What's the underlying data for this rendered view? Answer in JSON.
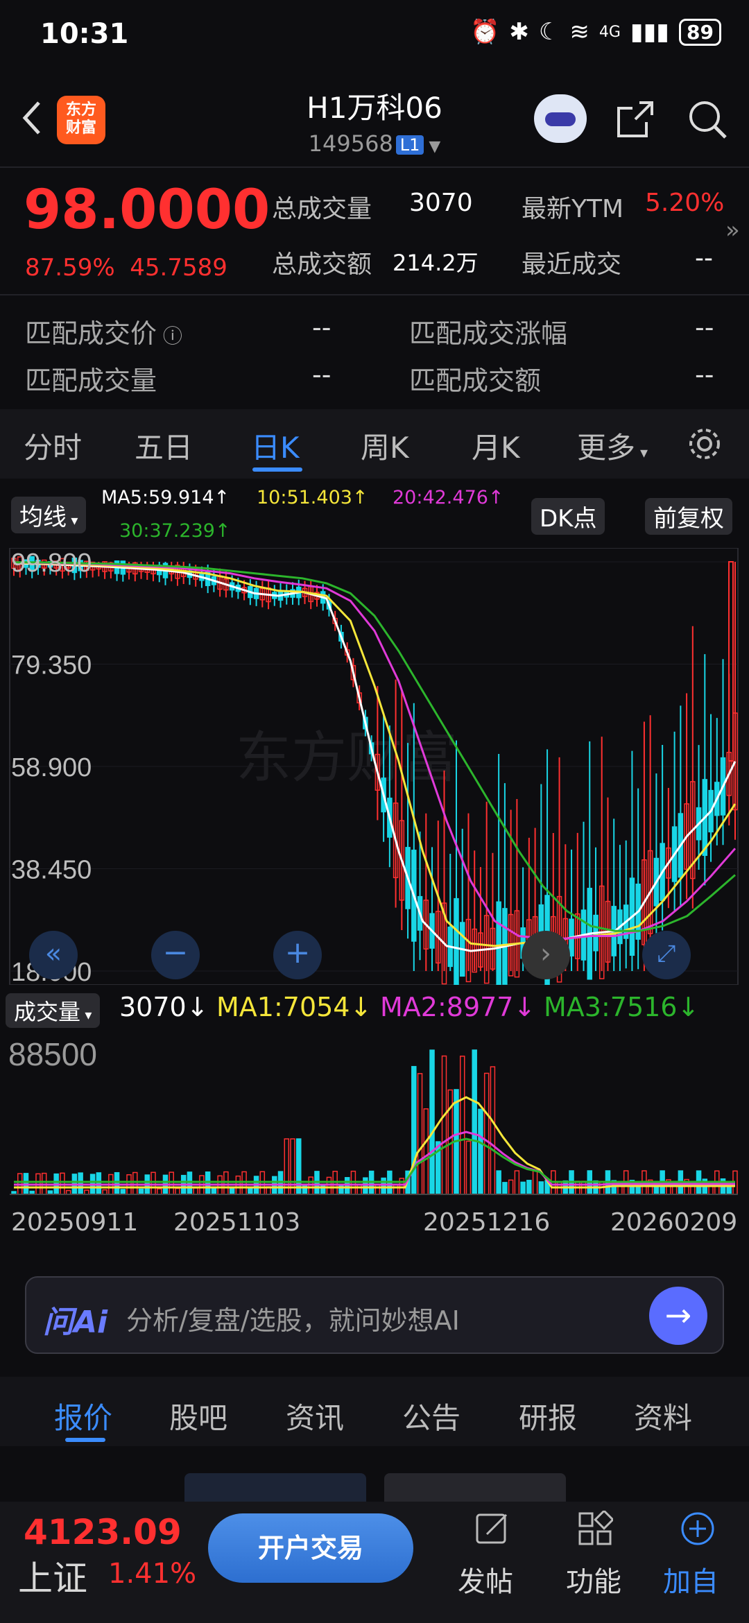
{
  "status": {
    "time": "10:31",
    "network": "4G",
    "battery": "89"
  },
  "header": {
    "logo_text_1": "东方",
    "logo_text_2": "财富",
    "bond_name": "H1万科06",
    "bond_code": "149568",
    "level_badge": "L1"
  },
  "quote": {
    "price": "98.0000",
    "change_pct": "87.59%",
    "change_abs": "45.7589",
    "total_volume_label": "总成交量",
    "total_volume": "3070",
    "latest_ytm_label": "最新YTM",
    "latest_ytm": "5.20%",
    "total_amount_label": "总成交额",
    "total_amount": "214.2万",
    "recent_trade_label": "最近成交",
    "recent_trade": "--",
    "match_price_label": "匹配成交价",
    "match_price": "--",
    "match_change_label": "匹配成交涨幅",
    "match_change": "--",
    "match_volume_label": "匹配成交量",
    "match_volume": "--",
    "match_amount_label": "匹配成交额",
    "match_amount": "--"
  },
  "tabs": [
    "分时",
    "五日",
    "日K",
    "周K",
    "月K",
    "更多"
  ],
  "active_tab": "日K",
  "kline": {
    "ma_button": "均线",
    "ma5": "MA5:59.914↑",
    "ma10": "10:51.403↑",
    "ma20": "20:42.476↑",
    "ma30": "30:37.239↑",
    "dk_button": "DK点",
    "adjust_button": "前复权",
    "watermark": "东方财富",
    "volume_label": "成交量",
    "volume_value": "3070↓",
    "vma1": "MA1:7054↓",
    "vma2": "MA2:8977↓",
    "vma3": "MA3:7516↓",
    "volume_max": "88500",
    "colors": {
      "ma5": "#ffffff",
      "ma10": "#f5e63a",
      "ma20": "#e03ad8",
      "ma30": "#2cb52c",
      "up": "#ff3030",
      "down": "#19d6e6"
    }
  },
  "chart_data": {
    "type": "candlestick",
    "y_ticks": [
      "99.800",
      "79.350",
      "58.900",
      "38.450",
      "18.000"
    ],
    "ylim": [
      18.0,
      99.8
    ],
    "x_ticks": [
      "20250911",
      "20251103",
      "20251216",
      "20260209"
    ],
    "ma_series": [
      {
        "name": "MA5",
        "values": [
          99.5,
          99.4,
          99.2,
          99.0,
          98.8,
          98.5,
          98.2,
          97.7,
          96.5,
          95.0,
          93.5,
          93.0,
          93.8,
          92.5,
          80.0,
          60.0,
          42.0,
          28.0,
          23.0,
          22.0,
          22.5,
          23.5,
          24.0,
          24.5,
          25.5,
          26.0,
          30.0,
          38.0,
          45.0,
          50.0,
          59.9
        ]
      },
      {
        "name": "10",
        "values": [
          99.6,
          99.5,
          99.4,
          99.2,
          99.0,
          98.8,
          98.5,
          98.0,
          97.5,
          96.5,
          95.0,
          94.0,
          93.8,
          93.0,
          88.0,
          75.0,
          60.0,
          42.0,
          28.0,
          23.5,
          23.0,
          23.5,
          24.0,
          24.5,
          25.0,
          25.5,
          27.0,
          32.0,
          38.0,
          44.0,
          51.4
        ]
      },
      {
        "name": "20",
        "values": [
          99.7,
          99.6,
          99.5,
          99.4,
          99.2,
          99.0,
          98.8,
          98.5,
          98.0,
          97.5,
          96.5,
          95.8,
          95.2,
          94.5,
          92.0,
          86.0,
          76.0,
          62.0,
          48.0,
          36.0,
          28.0,
          25.0,
          24.5,
          24.5,
          25.0,
          25.0,
          26.0,
          28.0,
          32.0,
          37.0,
          42.5
        ]
      },
      {
        "name": "30",
        "values": [
          99.7,
          99.7,
          99.6,
          99.5,
          99.4,
          99.2,
          99.0,
          98.8,
          98.5,
          98.0,
          97.5,
          97.0,
          96.5,
          95.5,
          93.5,
          89.0,
          82.0,
          74.0,
          66.0,
          58.0,
          50.0,
          42.0,
          35.0,
          30.0,
          27.0,
          26.0,
          26.0,
          27.0,
          29.0,
          33.0,
          37.2
        ]
      }
    ],
    "volume_series": [
      {
        "name": "MA1",
        "value": 7054
      },
      {
        "name": "MA2",
        "value": 8977
      },
      {
        "name": "MA3",
        "value": 7516
      }
    ],
    "volume_last": 3070
  },
  "ai_bar": {
    "label": "问Ai",
    "placeholder": "分析/复盘/选股，就问妙想AI"
  },
  "subtabs": [
    "报价",
    "股吧",
    "资讯",
    "公告",
    "研报",
    "资料"
  ],
  "bottom": {
    "index_value": "4123.09",
    "index_name": "上证",
    "index_pct": "1.41%",
    "trade_button": "开户交易",
    "post_label": "发帖",
    "func_label": "功能",
    "watch_label": "加自"
  }
}
